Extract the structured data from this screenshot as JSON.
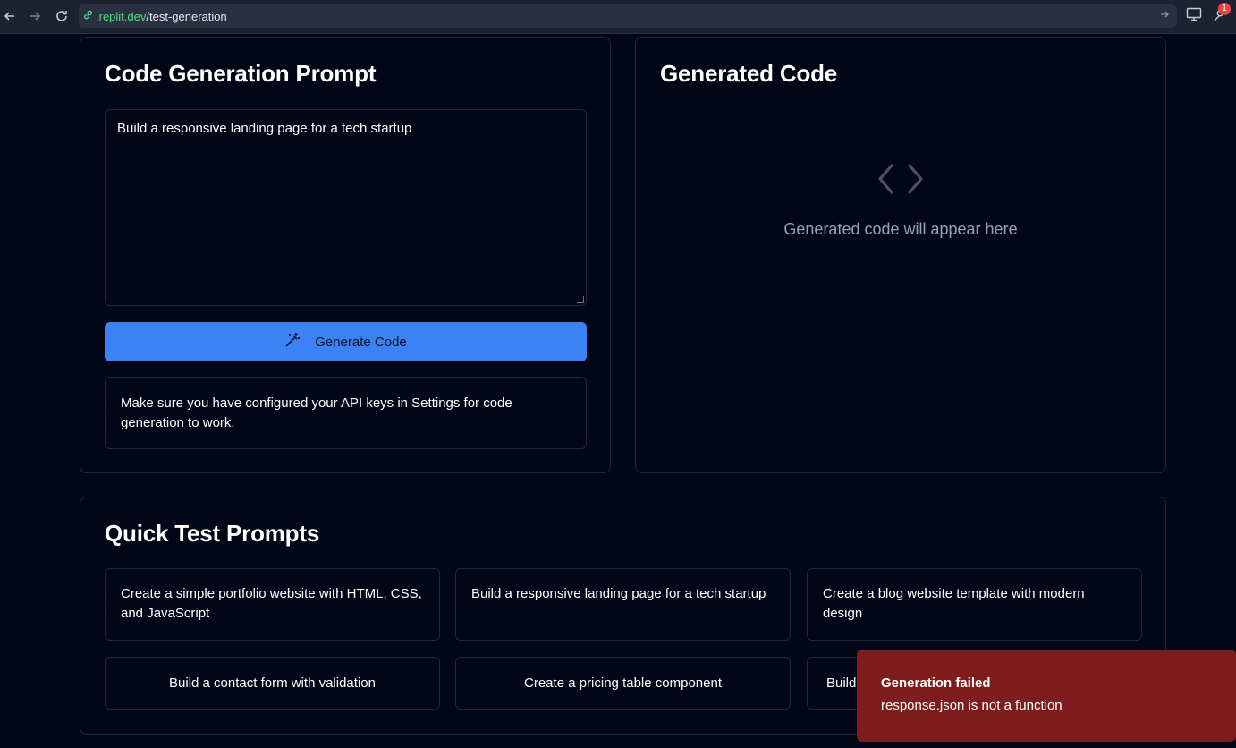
{
  "browser": {
    "url_domain": ".replit.dev",
    "url_path": "/test-generation",
    "notification_count": "1"
  },
  "prompt_card": {
    "title": "Code Generation Prompt",
    "textarea_value": "Build a responsive landing page for a tech startup",
    "button_label": "Generate Code",
    "info_text": "Make sure you have configured your API keys in Settings for code generation to work."
  },
  "output_card": {
    "title": "Generated Code",
    "placeholder": "Generated code will appear here"
  },
  "quick_card": {
    "title": "Quick Test Prompts",
    "prompts": [
      "Create a simple portfolio website with HTML, CSS, and JavaScript",
      "Build a responsive landing page for a tech startup",
      "Create a blog website template with modern design",
      "Build a contact form with validation",
      "Create a pricing table component",
      "Build"
    ]
  },
  "toast": {
    "title": "Generation failed",
    "message": "response.json is not a function"
  },
  "colors": {
    "background": "#020617",
    "accent": "#3b82f6",
    "toast": "#7f1d1d",
    "url_domain": "#4ade80"
  }
}
